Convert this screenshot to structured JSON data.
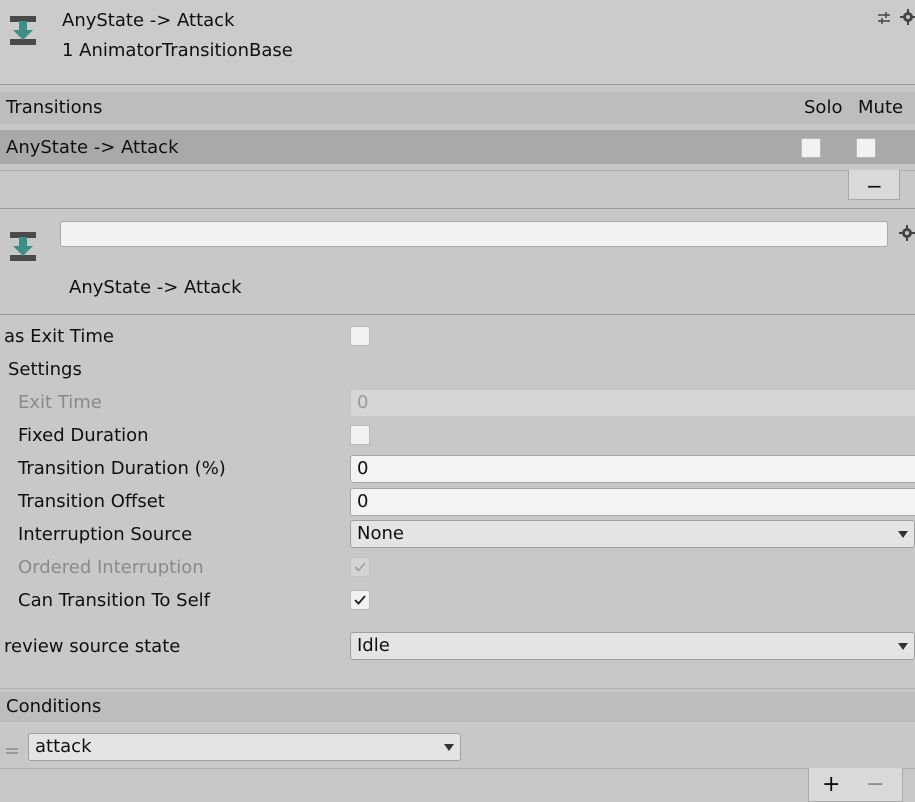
{
  "header": {
    "title": "AnyState -> Attack",
    "subtitle": "1 AnimatorTransitionBase"
  },
  "transitions_list": {
    "header_label": "Transitions",
    "col_solo": "Solo",
    "col_mute": "Mute",
    "rows": [
      {
        "name": "AnyState -> Attack",
        "solo": false,
        "mute": false
      }
    ],
    "remove_label": "−"
  },
  "transition": {
    "name_input_value": "",
    "title": "AnyState -> Attack"
  },
  "properties": {
    "has_exit_time": {
      "label": "as Exit Time",
      "checked": false
    },
    "settings_label": "Settings",
    "exit_time": {
      "label": "Exit Time",
      "value": "0"
    },
    "fixed_duration": {
      "label": "Fixed Duration",
      "checked": false
    },
    "transition_duration": {
      "label": "Transition Duration (%)",
      "value": "0"
    },
    "transition_offset": {
      "label": "Transition Offset",
      "value": "0"
    },
    "interruption_source": {
      "label": "Interruption Source",
      "value": "None"
    },
    "ordered_interruption": {
      "label": "Ordered Interruption",
      "checked": true
    },
    "can_transition_to_self": {
      "label": "Can Transition To Self",
      "checked": true
    },
    "preview_source_state": {
      "label": "review source state",
      "value": "Idle"
    }
  },
  "conditions": {
    "header_label": "Conditions",
    "items": [
      {
        "parameter": "attack"
      }
    ],
    "add_label": "+",
    "remove_label": "−"
  },
  "colors": {
    "background": "#c8c8c8",
    "header_bar": "#bdbdbd",
    "selected_row": "#a9a9a9",
    "icon_teal": "#3d8f86"
  }
}
